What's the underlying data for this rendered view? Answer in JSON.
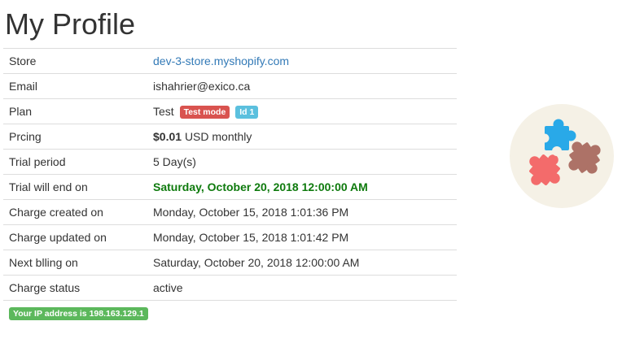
{
  "page": {
    "title": "My Profile"
  },
  "profile": {
    "store": {
      "label": "Store",
      "value": "dev-3-store.myshopify.com"
    },
    "email": {
      "label": "Email",
      "value": "ishahrier@exico.ca"
    },
    "plan": {
      "label": "Plan",
      "value": "Test",
      "mode_badge": "Test mode",
      "id_badge": "Id 1"
    },
    "pricing": {
      "label": "Prcing",
      "amount": "$0.01",
      "suffix": "USD monthly"
    },
    "trial_period": {
      "label": "Trial period",
      "value": "5 Day(s)"
    },
    "trial_end": {
      "label": "Trial will end on",
      "value": "Saturday, October 20, 2018 12:00:00 AM"
    },
    "charge_created": {
      "label": "Charge created on",
      "value": "Monday, October 15, 2018 1:01:36 PM"
    },
    "charge_updated": {
      "label": "Charge updated on",
      "value": "Monday, October 15, 2018 1:01:42 PM"
    },
    "next_billing": {
      "label": "Next blling on",
      "value": "Saturday, October 20, 2018 12:00:00 AM"
    },
    "charge_status": {
      "label": "Charge status",
      "value": "active"
    }
  },
  "ip_notice": "Your IP address is 198.163.129.1",
  "logo": {
    "icon": "puzzle-pieces-icon",
    "background": "#f5f1e6",
    "piece_colors": [
      "#29a9e8",
      "#ad7267",
      "#f36b6b"
    ]
  },
  "colors": {
    "link": "#337ab7",
    "danger": "#d9534f",
    "info": "#5bc0de",
    "success": "#5cb85c",
    "trial_end_text": "#0e7a0d"
  }
}
